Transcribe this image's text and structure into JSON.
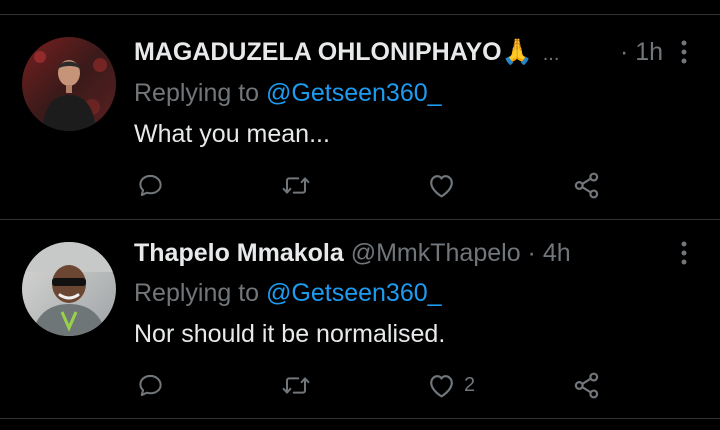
{
  "tweets": [
    {
      "name": "MAGADUZELA OHLONIPHAYO🙏",
      "handle": "",
      "truncated": "...",
      "dot": "·",
      "time": "1h",
      "replying_prefix": "Replying to ",
      "replying_handle": "@Getseen360_",
      "text": "What you mean...",
      "like_count": "",
      "avatar_icon": "user-photo-avatar"
    },
    {
      "name": "Thapelo Mmakola",
      "handle": "@MmkThapelo",
      "truncated": "",
      "dot": "·",
      "time": "4h",
      "replying_prefix": "Replying to ",
      "replying_handle": "@Getseen360_",
      "text": "Nor should it be normalised.",
      "like_count": "2",
      "avatar_icon": "user-photo-avatar"
    }
  ],
  "icons": {
    "reply": "reply-icon",
    "retweet": "retweet-icon",
    "like": "heart-icon",
    "share": "share-icon",
    "more": "more-vertical-icon"
  },
  "colors": {
    "background": "#000000",
    "text": "#e7e9ea",
    "muted": "#71767b",
    "link": "#1d9bf0",
    "divider": "#2f3336"
  }
}
